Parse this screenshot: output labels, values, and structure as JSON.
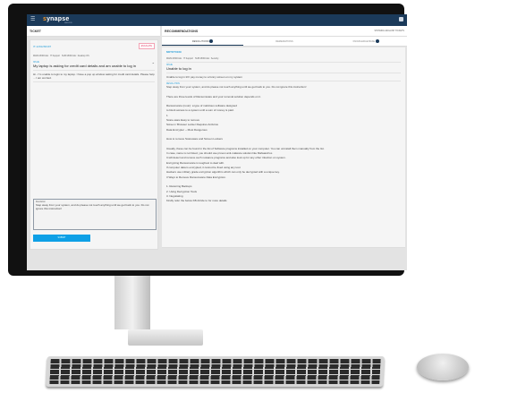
{
  "app": {
    "logo": "synapse",
    "logo_sub": "SERVICE"
  },
  "ticket": {
    "panel_title": "TICKET",
    "id": "IT-1291266497",
    "escalate": "ESCALATE",
    "main_module": "MAIN MODULE : IT Support",
    "sub_module": "SUB MODULE : Desktop OS",
    "issue_label": "ISSUE",
    "issue_title": "My laptop is asking for credit card details and am unable to log in",
    "issue_body": "Hi - I'm unable to login to my laptop. I have a pop up window asking for credit card details. Please help ... I am worried.",
    "resolution_label": "Resolution",
    "resolution_text": "Step away from your system, and do please not touch anything until we get back to you. Do not ignore this instruction!",
    "submit": "SUBMIT"
  },
  "recommendations": {
    "panel_title": "RECOMMENDATIONS",
    "language": "SHOWING ENGLISH TICKETS",
    "tabs": [
      {
        "label": "RESOLUTIONS",
        "badge": "10"
      },
      {
        "label": "REMEDIATIONS"
      },
      {
        "label": "KNOWLEDGE BASE",
        "badge": "2"
      }
    ],
    "id": "M0TKT0169",
    "main_module": "MAIN MODULE : IT Support",
    "sub_module": "SUB MODULE : Security",
    "issue_label": "ISSUE",
    "issue_title": "Unable to log in",
    "issue_body": "Unable to log in till I pay money to a funny screen on my system",
    "resolution_label": "RESOLUTION",
    "resolution_lines": [
      "Step away from your system, and do please not touch anything until we get back to you. Do not ignore this instruction!",
      "",
      "There are three levels of Ransomware and your removal solution depends on it.",
      "",
      "Ransomware (noun): a type of malicious software designed",
      "to block access to a system until a sum of money is paid.",
      "1",
      "Scare-ware Easy to remove",
      "Screen / Browser Locker Requires Antivirus",
      "Data Encrypter -- Most Dangerous",
      "",
      "How to remove Scareware and Screen Lockers",
      "",
      "Usually, these can be found in the list of Software programs installed on your computer. You can uninstall them manually from the list.",
      "In case, name is not listed, you should use proven anti-malware solution like MalwareFox.",
      "It will detect and remove such nuisance programs and also look up for any other infection on system.",
      "Encrypting Ransomware is toughest to deal with.",
      "If computer data is encrypted, it cannot be fixed using any tool.",
      "Hackers use military grade encryption algorithm which can only be decrypted with a unique key.",
      "3 Ways to Remove Ransomware Data Encryption.",
      "",
      "1. Restoring Backups",
      "2. Using Decryption Tools",
      "3. Negotiating",
      "Kindly refer the below KB Article to for more details"
    ]
  }
}
